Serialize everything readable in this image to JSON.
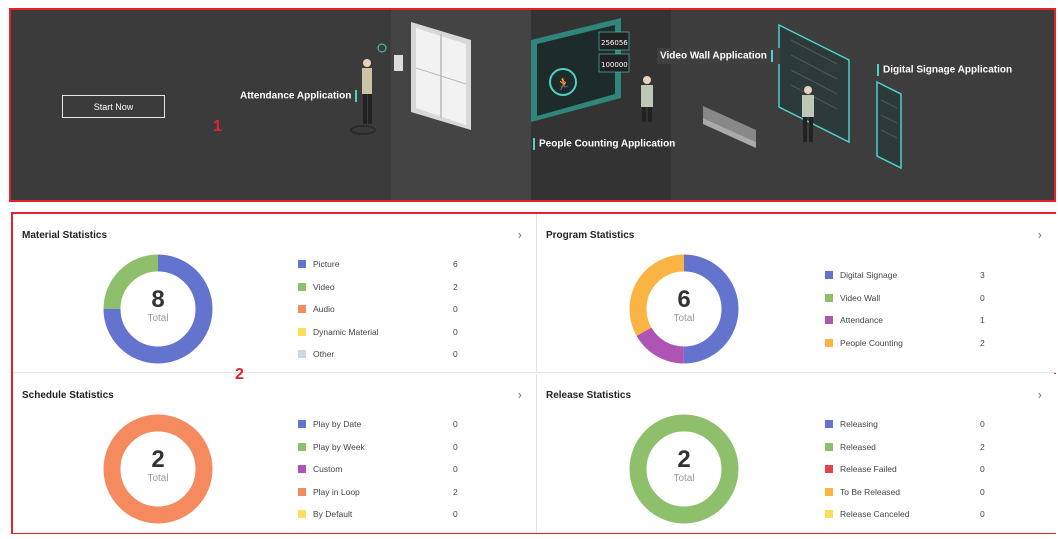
{
  "banner": {
    "start_button": "Start Now",
    "marker": "1",
    "apps": {
      "attendance": "Attendance Application",
      "people_counting": "People Counting Application",
      "video_wall": "Video Wall Application",
      "digital_signage": "Digital Signage Application"
    },
    "screen_numbers": [
      "256056",
      "100000"
    ]
  },
  "stats_marker": "2",
  "cards": {
    "material": {
      "title": "Material Statistics",
      "total": "8",
      "total_label": "Total",
      "items": [
        {
          "name": "Picture",
          "value": "6",
          "color": "#6474ce"
        },
        {
          "name": "Video",
          "value": "2",
          "color": "#8ec06c"
        },
        {
          "name": "Audio",
          "value": "0",
          "color": "#f58a5e"
        },
        {
          "name": "Dynamic Material",
          "value": "0",
          "color": "#f9df5a"
        },
        {
          "name": "Other",
          "value": "0",
          "color": "#c9d6ec"
        }
      ]
    },
    "program": {
      "title": "Program Statistics",
      "total": "6",
      "total_label": "Total",
      "items": [
        {
          "name": "Digital Signage",
          "value": "3",
          "color": "#6474ce"
        },
        {
          "name": "Video Wall",
          "value": "0",
          "color": "#8ec06c"
        },
        {
          "name": "Attendance",
          "value": "1",
          "color": "#ad54b5"
        },
        {
          "name": "People Counting",
          "value": "2",
          "color": "#f9b444"
        }
      ]
    },
    "schedule": {
      "title": "Schedule Statistics",
      "total": "2",
      "total_label": "Total",
      "items": [
        {
          "name": "Play by Date",
          "value": "0",
          "color": "#6474ce"
        },
        {
          "name": "Play by Week",
          "value": "0",
          "color": "#8ec06c"
        },
        {
          "name": "Custom",
          "value": "0",
          "color": "#ad54b5"
        },
        {
          "name": "Play in Loop",
          "value": "2",
          "color": "#f58a5e"
        },
        {
          "name": "By Default",
          "value": "0",
          "color": "#f9df5a"
        }
      ]
    },
    "release": {
      "title": "Release Statistics",
      "total": "2",
      "total_label": "Total",
      "items": [
        {
          "name": "Releasing",
          "value": "0",
          "color": "#6474ce"
        },
        {
          "name": "Released",
          "value": "2",
          "color": "#8ec06c"
        },
        {
          "name": "Release Failed",
          "value": "0",
          "color": "#e04848"
        },
        {
          "name": "To Be Released",
          "value": "0",
          "color": "#f9b444"
        },
        {
          "name": "Release Canceled",
          "value": "0",
          "color": "#f9df5a"
        }
      ]
    }
  }
}
